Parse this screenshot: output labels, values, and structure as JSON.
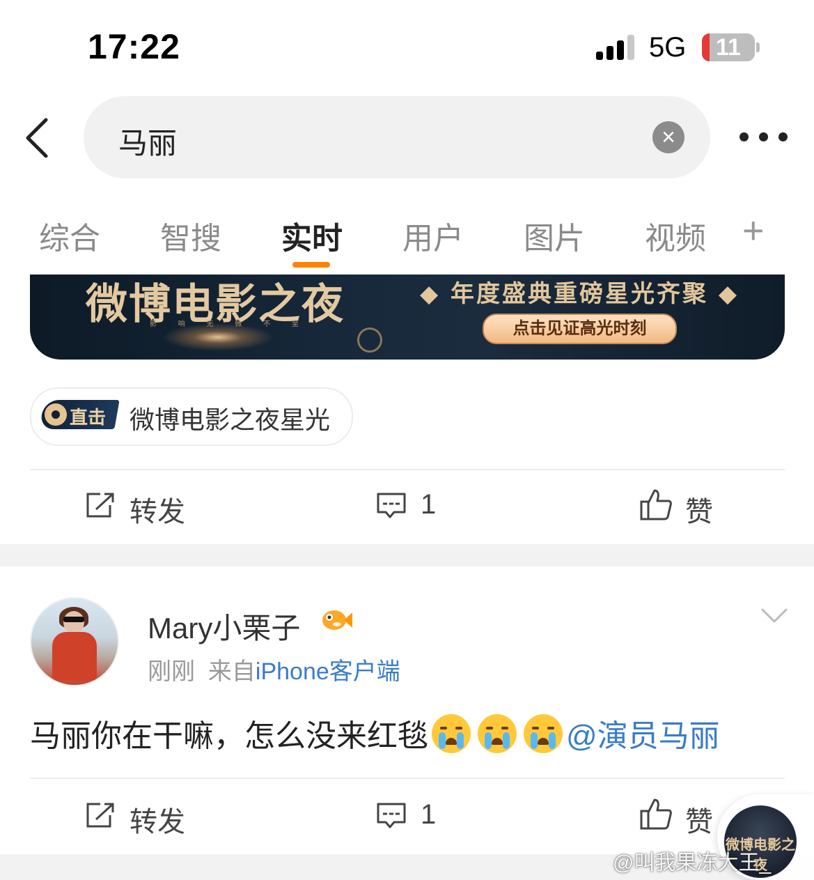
{
  "status_bar": {
    "time": "17:22",
    "network": "5G",
    "battery": "11"
  },
  "search": {
    "query": "马丽"
  },
  "tabs": [
    {
      "label": "综合"
    },
    {
      "label": "智搜"
    },
    {
      "label": "实时",
      "active": true
    },
    {
      "label": "用户"
    },
    {
      "label": "图片"
    },
    {
      "label": "视频"
    }
  ],
  "tab_add": "+",
  "banner": {
    "title": "微博电影之夜",
    "subtitle": "影 响 无 微 不 至",
    "slogan": "◆ 年度盛典重磅星光齐聚 ◆",
    "button": "点击见证高光时刻"
  },
  "topic_chip": {
    "badge": "直击",
    "label": "微博电影之夜星光"
  },
  "post1_actions": {
    "repost": "转发",
    "comments": "1",
    "like": "赞"
  },
  "post2": {
    "username": "Mary小栗子",
    "time": "刚刚",
    "source_prefix": "来自",
    "source": "iPhone客户端",
    "text_before": "马丽你在干嘛，怎么没来红毯",
    "emoji_icon": "crying-face",
    "emoji_count": 3,
    "mention": "@演员马丽",
    "actions": {
      "repost": "转发",
      "comments": "1",
      "like": "赞"
    }
  },
  "floating_button": {
    "label": "微博电影之夜"
  },
  "watermark": "@叫我果冻大王_",
  "colors": {
    "accent": "#ff8200",
    "link": "#3a7cc9",
    "muted": "#999999"
  }
}
